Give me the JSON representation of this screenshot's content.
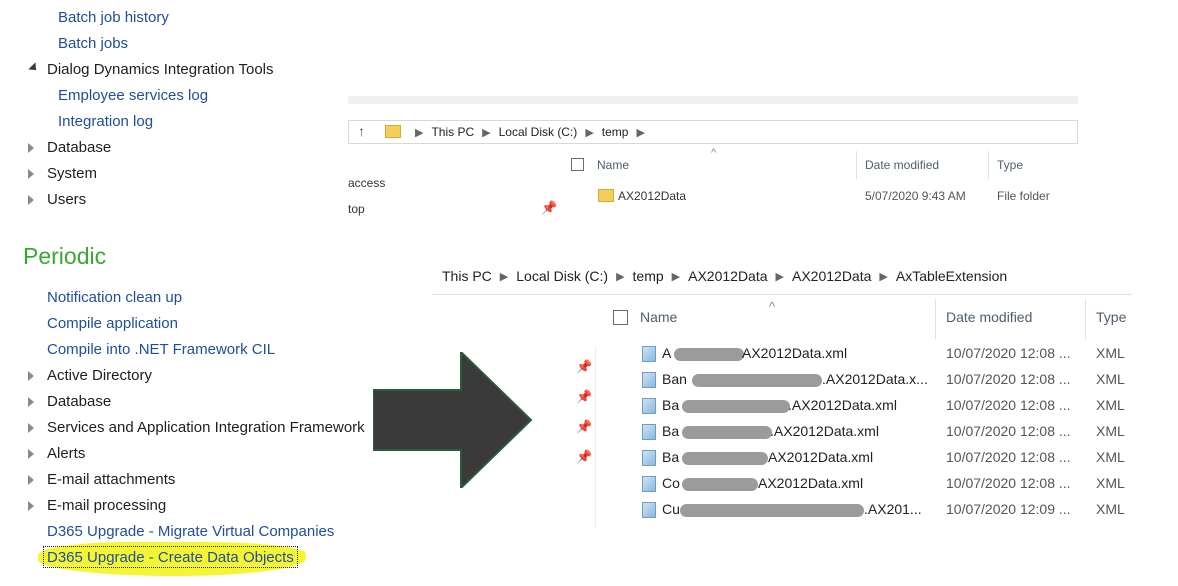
{
  "nav": {
    "top_items": [
      {
        "label": "Batch job history",
        "type": "link"
      },
      {
        "label": "Batch jobs",
        "type": "link"
      },
      {
        "label": "Dialog Dynamics Integration Tools",
        "type": "expanded"
      },
      {
        "label": "Employee services log",
        "type": "link"
      },
      {
        "label": "Integration log",
        "type": "link"
      },
      {
        "label": "Database",
        "type": "collapsed"
      },
      {
        "label": "System",
        "type": "collapsed"
      },
      {
        "label": "Users",
        "type": "collapsed"
      }
    ],
    "section_title": "Periodic",
    "periodic_items": [
      {
        "label": "Notification clean up",
        "type": "link"
      },
      {
        "label": "Compile application",
        "type": "link"
      },
      {
        "label": "Compile into .NET Framework CIL",
        "type": "link"
      },
      {
        "label": "Active Directory",
        "type": "collapsed"
      },
      {
        "label": "Database",
        "type": "collapsed"
      },
      {
        "label": "Services and Application Integration Framework",
        "type": "collapsed"
      },
      {
        "label": "Alerts",
        "type": "collapsed"
      },
      {
        "label": "E-mail attachments",
        "type": "collapsed"
      },
      {
        "label": "E-mail processing",
        "type": "collapsed"
      },
      {
        "label": "D365 Upgrade - Migrate Virtual Companies",
        "type": "link"
      },
      {
        "label": "D365 Upgrade - Create Data Objects",
        "type": "link-highlighted"
      }
    ]
  },
  "explorer1": {
    "sidebar": [
      "access",
      "top"
    ],
    "breadcrumb": [
      "This PC",
      "Local Disk (C:)",
      "temp"
    ],
    "columns": {
      "name": "Name",
      "date": "Date modified",
      "type": "Type"
    },
    "rows": [
      {
        "name": "AX2012Data",
        "date": "5/07/2020 9:43 AM",
        "type": "File folder"
      }
    ]
  },
  "explorer2": {
    "breadcrumb": [
      "This PC",
      "Local Disk (C:)",
      "temp",
      "AX2012Data",
      "AX2012Data",
      "AxTableExtension"
    ],
    "columns": {
      "name": "Name",
      "date": "Date modified",
      "type": "Type"
    },
    "rows": [
      {
        "prefix": "A",
        "suffix": "AX2012Data.xml",
        "date": "10/07/2020 12:08 ...",
        "type": "XML"
      },
      {
        "prefix": "Ban",
        "suffix": ".AX2012Data.x...",
        "date": "10/07/2020 12:08 ...",
        "type": "XML"
      },
      {
        "prefix": "Ba",
        "suffix": ".AX2012Data.xml",
        "date": "10/07/2020 12:08 ...",
        "type": "XML"
      },
      {
        "prefix": "Ba",
        "suffix": ".AX2012Data.xml",
        "date": "10/07/2020 12:08 ...",
        "type": "XML"
      },
      {
        "prefix": "Ba",
        "suffix": "AX2012Data.xml",
        "date": "10/07/2020 12:08 ...",
        "type": "XML"
      },
      {
        "prefix": "Co",
        "suffix": "AX2012Data.xml",
        "date": "10/07/2020 12:08 ...",
        "type": "XML"
      },
      {
        "prefix": "Cu",
        "suffix": ".AX201...",
        "date": "10/07/2020 12:09 ...",
        "type": "XML"
      }
    ]
  },
  "colors": {
    "link": "#1f4e9c",
    "section": "#3aa832",
    "highlight": "#f4f535",
    "arrow": "#3a3a3a"
  }
}
